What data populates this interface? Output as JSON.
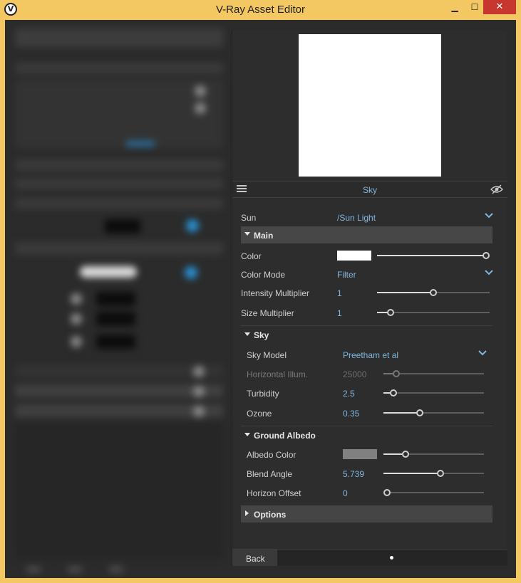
{
  "window": {
    "title": "V-Ray Asset Editor",
    "logo_glyph": "V",
    "minimize_glyph": "▁",
    "maximize_glyph": "☐",
    "close_glyph": "✕"
  },
  "panel": {
    "header_title": "Sky",
    "sun": {
      "label": "Sun",
      "value": "/Sun Light"
    },
    "main": {
      "title": "Main",
      "color": {
        "label": "Color",
        "swatch": "#ffffff",
        "level": 1.0
      },
      "color_mode": {
        "label": "Color Mode",
        "value": "Filter"
      },
      "intensity": {
        "label": "Intensity Multiplier",
        "value": "1",
        "level": 0.5
      },
      "size": {
        "label": "Size Multiplier",
        "value": "1",
        "level": 0.12
      }
    },
    "sky": {
      "title": "Sky",
      "model": {
        "label": "Sky Model",
        "value": "Preetham et al"
      },
      "horizontal_illum": {
        "label": "Horizontal Illum.",
        "value": "25000",
        "level": 0.13
      },
      "turbidity": {
        "label": "Turbidity",
        "value": "2.5",
        "level": 0.1
      },
      "ozone": {
        "label": "Ozone",
        "value": "0.35",
        "level": 0.36
      }
    },
    "ground_albedo": {
      "title": "Ground Albedo",
      "albedo_color": {
        "label": "Albedo Color",
        "swatch": "#808080",
        "level": 0.22
      },
      "blend_angle": {
        "label": "Blend Angle",
        "value": "5.739",
        "level": 0.57
      },
      "horizon_offset": {
        "label": "Horizon Offset",
        "value": "0",
        "level": 0.0
      }
    },
    "options": {
      "title": "Options"
    },
    "footer": {
      "back_label": "Back"
    }
  },
  "colors": {
    "accent": "#7fb6e0",
    "panel_bg": "#2d2d2d",
    "section_bg": "#474747",
    "title_bar": "#f3c862",
    "close_button": "#c7372f"
  },
  "icons": {
    "list": "list-icon",
    "eye": "eye-hidden-icon",
    "chevron": "chevron-down-icon"
  }
}
